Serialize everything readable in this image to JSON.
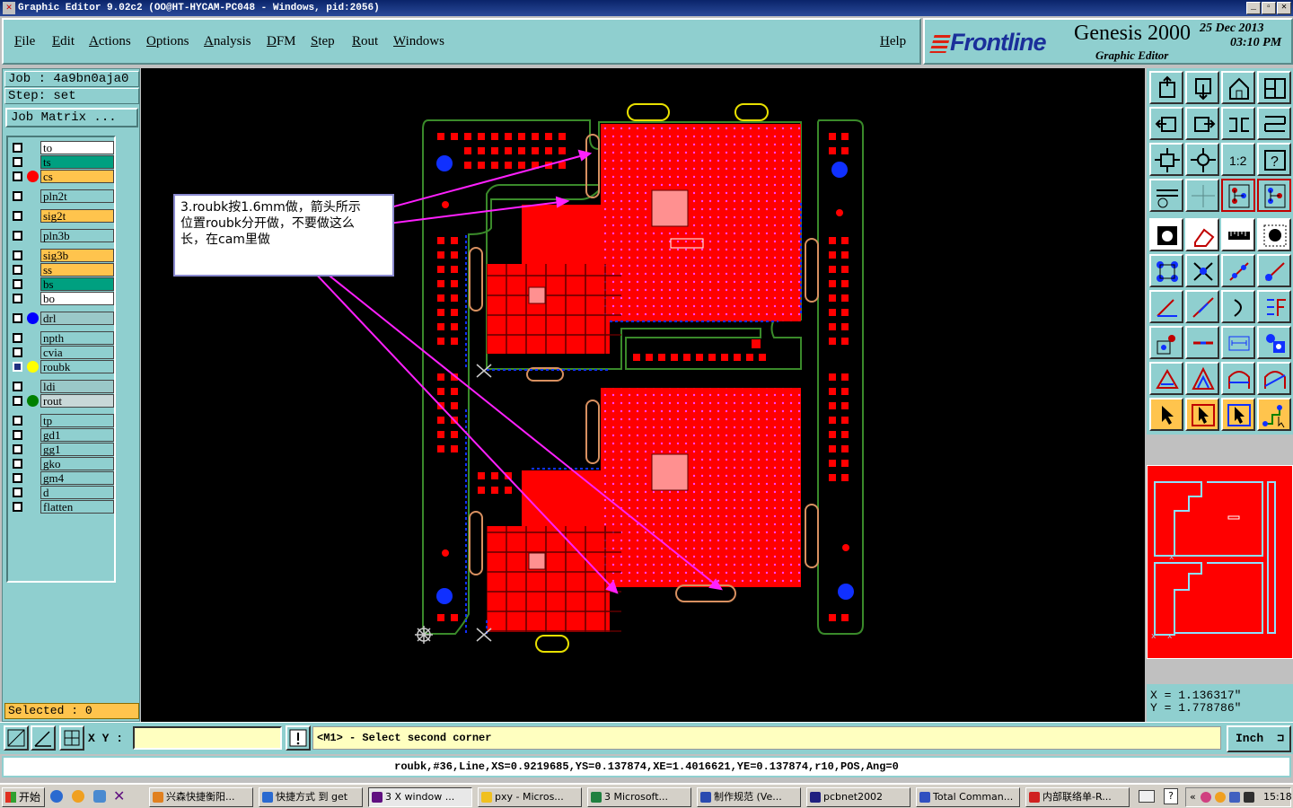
{
  "window": {
    "title": "Graphic Editor 9.02c2  (OO@HT-HYCAM-PC048 - Windows, pid:2056)"
  },
  "menu": {
    "items": [
      "File",
      "Edit",
      "Actions",
      "Options",
      "Analysis",
      "DFM",
      "Step",
      "Rout",
      "Windows"
    ],
    "help": "Help"
  },
  "logo": {
    "brand": "Frontline",
    "product": "Genesis 2000",
    "subtitle": "Graphic Editor",
    "date": "25 Dec 2013",
    "time": "03:10 PM"
  },
  "job": {
    "job_label": "Job : 4a9bn0aja0",
    "step_label": "Step: set",
    "matrix_button": "Job Matrix ..."
  },
  "layers": [
    {
      "name": "to",
      "color": "#ffffff",
      "dot": ""
    },
    {
      "name": "ts",
      "color": "#00a080",
      "dot": ""
    },
    {
      "name": "cs",
      "color": "#ffc44d",
      "dot": "#ff0000"
    },
    {
      "name": "pln2t",
      "color": "#8fcfcf",
      "dot": ""
    },
    {
      "name": "sig2t",
      "color": "#ffc44d",
      "dot": ""
    },
    {
      "name": "pln3b",
      "color": "#8fcfcf",
      "dot": ""
    },
    {
      "name": "sig3b",
      "color": "#ffc44d",
      "dot": ""
    },
    {
      "name": "ss",
      "color": "#ffc44d",
      "dot": ""
    },
    {
      "name": "bs",
      "color": "#00a080",
      "dot": ""
    },
    {
      "name": "bo",
      "color": "#ffffff",
      "dot": ""
    },
    {
      "name": "drl",
      "color": "#9ac8c8",
      "dot": "#0000ff"
    },
    {
      "name": "npth",
      "color": "#8fcfcf",
      "dot": ""
    },
    {
      "name": "cvia",
      "color": "#8fcfcf",
      "dot": ""
    },
    {
      "name": "roubk",
      "color": "#8fcfcf",
      "dot": "#ffff00",
      "active": true
    },
    {
      "name": "ldi",
      "color": "#9ac8c8",
      "dot": ""
    },
    {
      "name": "rout",
      "color": "#c8d8d8",
      "dot": "#008000"
    },
    {
      "name": "tp",
      "color": "#8fcfcf",
      "dot": ""
    },
    {
      "name": "gd1",
      "color": "#8fcfcf",
      "dot": ""
    },
    {
      "name": "gg1",
      "color": "#8fcfcf",
      "dot": ""
    },
    {
      "name": "gko",
      "color": "#8fcfcf",
      "dot": ""
    },
    {
      "name": "gm4",
      "color": "#8fcfcf",
      "dot": ""
    },
    {
      "name": "d",
      "color": "#8fcfcf",
      "dot": ""
    },
    {
      "name": "flatten",
      "color": "#8fcfcf",
      "dot": ""
    }
  ],
  "selected_label": "Selected : 0",
  "annotation": {
    "line1": "3.roubk按1.6mm做，箭头所示",
    "line2": "位置roubk分开做，不要做这么",
    "line3": "长，在cam里做"
  },
  "coords": {
    "x": "X  =  1.136317\"",
    "y": "Y  =  1.778786\""
  },
  "bottom": {
    "xy_label": "X Y :",
    "xy_value": "",
    "prompt": "<M1> - Select second corner",
    "units": "Inch"
  },
  "status_line": "roubk,#36,Line,XS=0.9219685,YS=0.137874,XE=1.4016621,YE=0.137874,r10,POS,Ang=0",
  "taskbar": {
    "start": "开始",
    "tasks": [
      "兴森快捷衡阳...",
      "快捷方式 到 get",
      "3 X window ...",
      "pxy - Micros...",
      "3 Microsoft...",
      "制作规范 (Ve...",
      "pcbnet2002",
      "Total Comman...",
      "内部联络单-R..."
    ],
    "clock": "15:18"
  }
}
